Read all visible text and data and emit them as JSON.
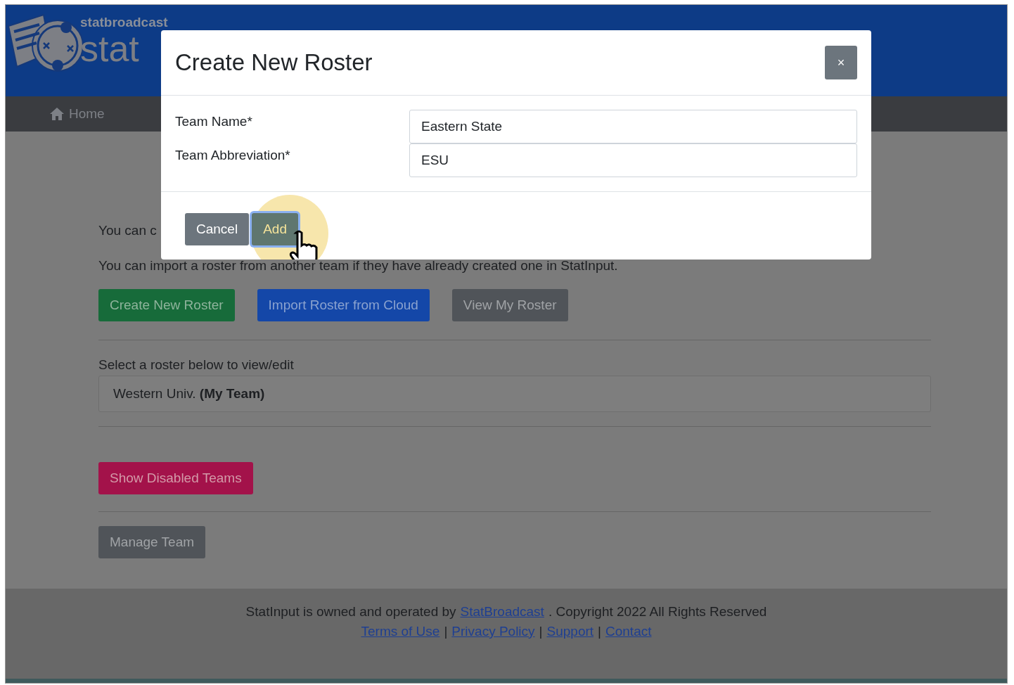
{
  "header": {
    "brand_small": "statbroadcast",
    "brand_large": "stat"
  },
  "nav": {
    "items": [
      {
        "label": "Home"
      }
    ]
  },
  "content": {
    "intro_partial": "You can c",
    "import_text": "You can import a roster from another team if they have already created one in StatInput.",
    "buttons": [
      {
        "label": "Create New Roster",
        "kind": "success"
      },
      {
        "label": "Import Roster from Cloud",
        "kind": "primary"
      },
      {
        "label": "View My Roster",
        "kind": "secondary"
      }
    ],
    "select_label": "Select a roster below to view/edit",
    "roster": "Western Univ. **(My Team)**",
    "disabled_button": "Show Disabled Teams",
    "manage_button": "Manage Team"
  },
  "modal": {
    "title": "Create New Roster",
    "close": "×",
    "fields": [
      {
        "label": "Team Name*",
        "value": "Eastern State"
      },
      {
        "label": "Team Abbreviation*",
        "value": "ESU"
      }
    ],
    "buttons": [
      {
        "label": "Cancel",
        "kind": "secondary",
        "focused": false
      },
      {
        "label": "Add",
        "kind": "primary",
        "focused": true
      }
    ]
  },
  "footer": {
    "text_before": "StatInput is owned and operated by",
    "link": "StatBroadcast",
    "text_after": ". Copyright 2022 All Rights Reserved",
    "separator": "|",
    "links": [
      "Terms of Use",
      "Privacy Policy",
      "Support",
      "Contact"
    ]
  }
}
